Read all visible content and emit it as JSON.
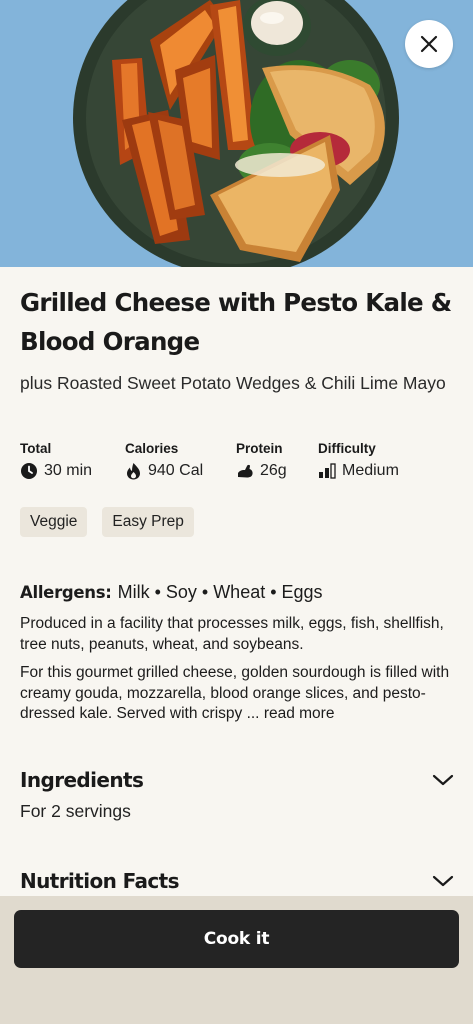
{
  "recipe": {
    "title": "Grilled Cheese with Pesto Kale & Blood Orange",
    "subtitle": "plus Roasted Sweet Potato Wedges & Chili Lime Mayo"
  },
  "stats": [
    {
      "label": "Total",
      "value": "30 min",
      "icon": "clock-icon"
    },
    {
      "label": "Calories",
      "value": "940 Cal",
      "icon": "flame-icon"
    },
    {
      "label": "Protein",
      "value": "26g",
      "icon": "muscle-icon"
    },
    {
      "label": "Difficulty",
      "value": "Medium",
      "icon": "difficulty-bars-icon"
    }
  ],
  "tags": [
    "Veggie",
    "Easy Prep"
  ],
  "allergens": {
    "label": "Allergens:",
    "items": "Milk • Soy • Wheat • Eggs",
    "facility": "Produced in a facility that processes milk, eggs, fish, shellfish, tree nuts, peanuts, wheat, and soybeans."
  },
  "description": {
    "text": "For this gourmet grilled cheese, golden sourdough is filled with creamy gouda, mozzarella, blood orange slices, and pesto-dressed kale. Served with crispy ...",
    "read_more": "read more"
  },
  "sections": {
    "ingredients_title": "Ingredients",
    "servings": "For 2 servings",
    "nutrition_title": "Nutrition Facts"
  },
  "actions": {
    "cook_label": "Cook it"
  },
  "colors": {
    "background": "#f8f6f1",
    "hero_sky": "#7fb1d8",
    "plate": "#2f3d2f",
    "button": "#242424",
    "bottom_bar": "#e0dace",
    "tag_bg": "#ebe6dc"
  }
}
